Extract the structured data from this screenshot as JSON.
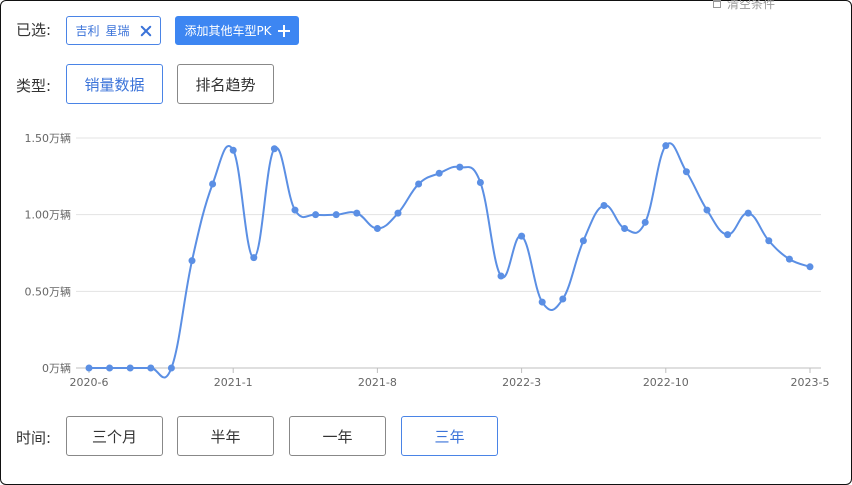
{
  "filters": {
    "selected_label": "已选:",
    "selected_tag": {
      "brand": "吉利",
      "model": "星瑞"
    },
    "add_button_label": "添加其他车型PK",
    "clear_label": "清空条件"
  },
  "type_selector": {
    "label": "类型:",
    "options": [
      "销量数据",
      "排名趋势"
    ],
    "active": 0
  },
  "time_selector": {
    "label": "时间:",
    "options": [
      "三个月",
      "半年",
      "一年",
      "三年"
    ],
    "active": 3
  },
  "chart_data": {
    "type": "line",
    "unit": "万辆",
    "ylim": [
      0,
      1.5
    ],
    "yticks": [
      "0万辆",
      "0.50万辆",
      "1.00万辆",
      "1.50万辆"
    ],
    "xtick_labels": [
      "2020-6",
      "2021-1",
      "2021-8",
      "2022-3",
      "2022-10",
      "2023-5"
    ],
    "x": [
      "2020-6",
      "2020-7",
      "2020-8",
      "2020-9",
      "2020-10",
      "2020-11",
      "2020-12",
      "2021-1",
      "2021-2",
      "2021-3",
      "2021-4",
      "2021-5",
      "2021-6",
      "2021-7",
      "2021-8",
      "2021-9",
      "2021-10",
      "2021-11",
      "2021-12",
      "2022-1",
      "2022-2",
      "2022-3",
      "2022-4",
      "2022-5",
      "2022-6",
      "2022-7",
      "2022-8",
      "2022-9",
      "2022-10",
      "2022-11",
      "2022-12",
      "2023-1",
      "2023-2",
      "2023-3",
      "2023-4",
      "2023-5"
    ],
    "values": [
      0,
      0,
      0,
      0,
      0,
      0.7,
      1.2,
      1.42,
      0.72,
      1.43,
      1.03,
      1.0,
      1.0,
      1.01,
      0.91,
      1.01,
      1.2,
      1.27,
      1.31,
      1.21,
      0.6,
      0.86,
      0.43,
      0.45,
      0.83,
      1.06,
      0.91,
      0.95,
      1.45,
      1.28,
      1.03,
      0.87,
      1.01,
      0.83,
      0.71,
      0.66
    ],
    "grid": true,
    "legend": "none",
    "line_color": "#5b8fe4"
  }
}
